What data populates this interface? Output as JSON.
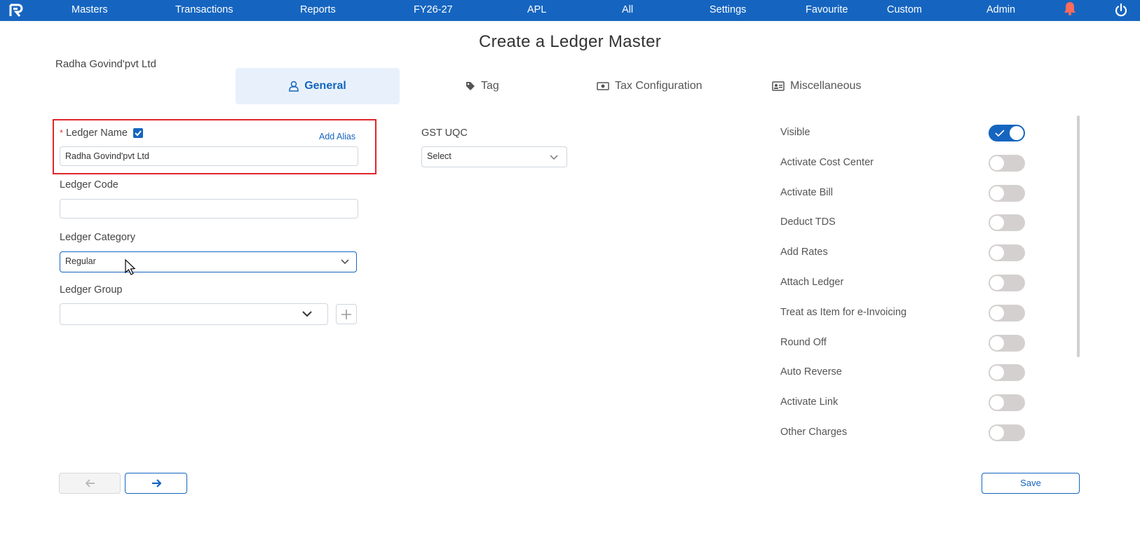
{
  "nav": {
    "items": [
      "Masters",
      "Transactions",
      "Reports",
      "FY26-27",
      "APL",
      "All",
      "Settings",
      "Favourite",
      "Custom",
      "Admin"
    ]
  },
  "page": {
    "title": "Create a Ledger Master",
    "company": "Radha Govind'pvt Ltd"
  },
  "tabs": [
    {
      "label": "General",
      "icon": "user-icon",
      "active": true
    },
    {
      "label": "Tag",
      "icon": "tag-icon",
      "active": false
    },
    {
      "label": "Tax Configuration",
      "icon": "money-icon",
      "active": false
    },
    {
      "label": "Miscellaneous",
      "icon": "id-card-icon",
      "active": false
    }
  ],
  "form": {
    "required_mark": "*",
    "ledger_name_label": "Ledger Name",
    "add_alias": "Add Alias",
    "ledger_name_value": "Radha Govind'pvt Ltd",
    "ledger_code_label": "Ledger Code",
    "ledger_code_value": "",
    "ledger_category_label": "Ledger Category",
    "ledger_category_value": "Regular",
    "ledger_group_label": "Ledger Group",
    "ledger_group_value": "",
    "gst_uqc_label": "GST UQC",
    "gst_uqc_value": "Select"
  },
  "toggles": [
    {
      "label": "Visible",
      "on": true
    },
    {
      "label": "Activate Cost Center",
      "on": false
    },
    {
      "label": "Activate Bill",
      "on": false
    },
    {
      "label": "Deduct TDS",
      "on": false
    },
    {
      "label": "Add Rates",
      "on": false
    },
    {
      "label": "Attach Ledger",
      "on": false
    },
    {
      "label": "Treat as Item for e-Invoicing",
      "on": false
    },
    {
      "label": "Round Off",
      "on": false
    },
    {
      "label": "Auto Reverse",
      "on": false
    },
    {
      "label": "Activate Link",
      "on": false
    },
    {
      "label": "Other Charges",
      "on": false
    }
  ],
  "footer": {
    "save_label": "Save"
  },
  "colors": {
    "primary": "#1565c0",
    "highlight": "#e0252b",
    "toggle_off": "#d5d0d0"
  }
}
